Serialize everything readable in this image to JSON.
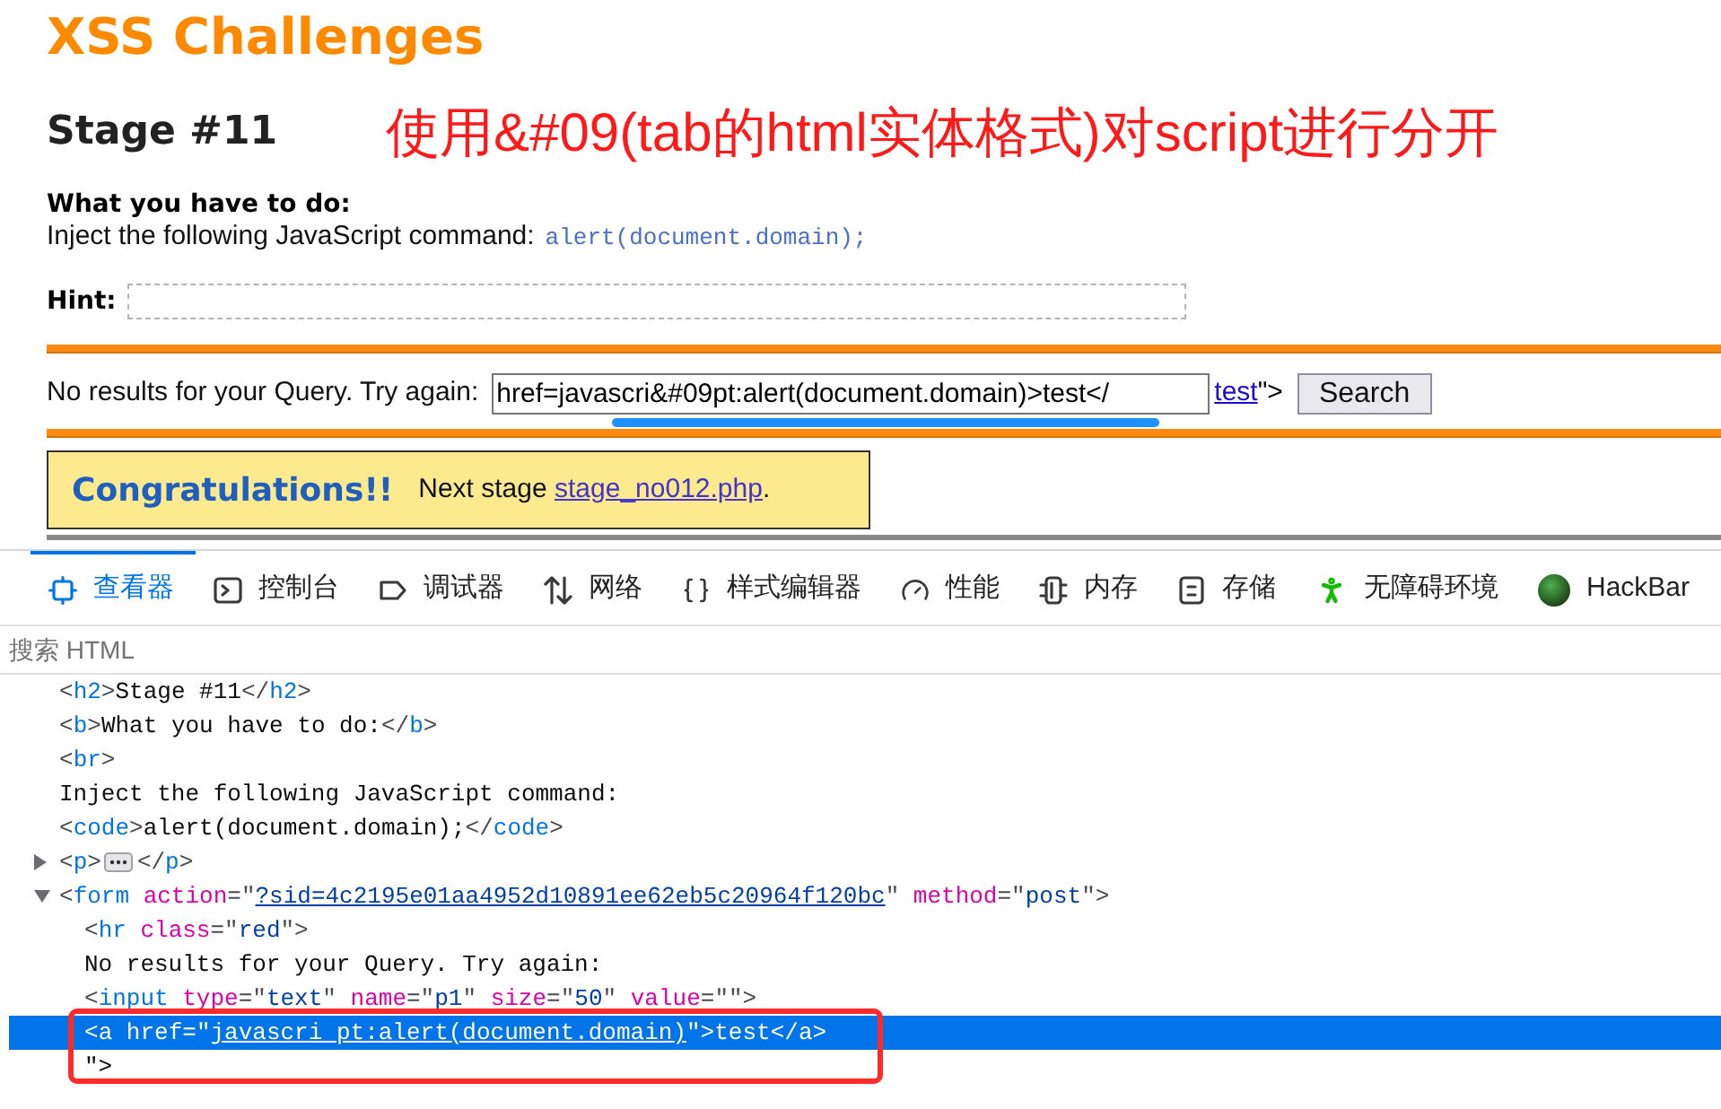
{
  "page": {
    "title": "XSS Challenges",
    "stage": "Stage #11",
    "annotation": "使用&#09(tab的html实体格式)对script进行分开",
    "task": {
      "heading": "What you have to do:",
      "text": "Inject the following JavaScript command:",
      "code": "alert(document.domain);"
    },
    "hint": {
      "label": "Hint:"
    },
    "query": {
      "text": "No results for your Query. Try again:",
      "value": "href=javascri&#09pt:alert(document.domain)>test</",
      "link": "test",
      "tail": "\">",
      "button": "Search"
    },
    "result": {
      "title": "Congratulations!!",
      "text": "Next stage",
      "link": "stage_no012.php",
      "end": "."
    }
  },
  "devtools": {
    "tabs": [
      {
        "label": "查看器",
        "selected": true
      },
      {
        "label": "控制台",
        "selected": false
      },
      {
        "label": "调试器",
        "selected": false
      },
      {
        "label": "网络",
        "selected": false
      },
      {
        "label": "样式编辑器",
        "selected": false
      },
      {
        "label": "性能",
        "selected": false
      },
      {
        "label": "内存",
        "selected": false
      },
      {
        "label": "存储",
        "selected": false
      },
      {
        "label": "无障碍环境",
        "selected": false
      },
      {
        "label": "HackBar",
        "selected": false
      }
    ],
    "search": {
      "placeholder": "搜索 HTML"
    },
    "tree": [
      {
        "kind": "leaf",
        "selected": false,
        "tokens": [
          {
            "kind": "punct",
            "text": "<"
          },
          {
            "kind": "tag",
            "text": "h2"
          },
          {
            "kind": "punct",
            "text": ">"
          },
          {
            "kind": "text",
            "text": "Stage #11"
          },
          {
            "kind": "punct",
            "text": "</"
          },
          {
            "kind": "tag",
            "text": "h2"
          },
          {
            "kind": "punct",
            "text": ">"
          }
        ]
      },
      {
        "kind": "leaf",
        "selected": false,
        "tokens": [
          {
            "kind": "punct",
            "text": "<"
          },
          {
            "kind": "tag",
            "text": "b"
          },
          {
            "kind": "punct",
            "text": ">"
          },
          {
            "kind": "text",
            "text": "What you have to do:"
          },
          {
            "kind": "punct",
            "text": "</"
          },
          {
            "kind": "tag",
            "text": "b"
          },
          {
            "kind": "punct",
            "text": ">"
          }
        ]
      },
      {
        "kind": "leaf",
        "selected": false,
        "tokens": [
          {
            "kind": "punct",
            "text": "<"
          },
          {
            "kind": "tag",
            "text": "br"
          },
          {
            "kind": "punct",
            "text": ">"
          }
        ]
      },
      {
        "kind": "leaf",
        "selected": false,
        "tokens": [
          {
            "kind": "text",
            "text": "Inject the following JavaScript command:"
          }
        ]
      },
      {
        "kind": "leaf",
        "selected": false,
        "tokens": [
          {
            "kind": "punct",
            "text": "<"
          },
          {
            "kind": "tag",
            "text": "code"
          },
          {
            "kind": "punct",
            "text": ">"
          },
          {
            "kind": "text",
            "text": "alert(document.domain);"
          },
          {
            "kind": "punct",
            "text": "</"
          },
          {
            "kind": "tag",
            "text": "code"
          },
          {
            "kind": "punct",
            "text": ">"
          }
        ]
      },
      {
        "kind": "container",
        "expanded": false,
        "selected": false,
        "tokens": [
          {
            "kind": "punct",
            "text": "<"
          },
          {
            "kind": "tag",
            "text": "p"
          },
          {
            "kind": "punct",
            "text": ">"
          },
          {
            "kind": "ellipsis"
          },
          {
            "kind": "punct",
            "text": "</"
          },
          {
            "kind": "tag",
            "text": "p"
          },
          {
            "kind": "punct",
            "text": ">"
          }
        ]
      },
      {
        "kind": "container",
        "expanded": true,
        "selected": false,
        "tokens": [
          {
            "kind": "punct",
            "text": "<"
          },
          {
            "kind": "tag",
            "text": "form"
          },
          {
            "kind": "attr",
            "text": " action"
          },
          {
            "kind": "punct",
            "text": "=\""
          },
          {
            "kind": "link",
            "text": "?sid=4c2195e01aa4952d10891ee62eb5c20964f120bc"
          },
          {
            "kind": "punct",
            "text": "\""
          },
          {
            "kind": "attr",
            "text": " method"
          },
          {
            "kind": "punct",
            "text": "=\""
          },
          {
            "kind": "value",
            "text": "post"
          },
          {
            "kind": "punct",
            "text": "\">"
          }
        ],
        "children": [
          {
            "kind": "leaf",
            "selected": false,
            "tokens": [
              {
                "kind": "punct",
                "text": "<"
              },
              {
                "kind": "tag",
                "text": "hr"
              },
              {
                "kind": "attr",
                "text": " class"
              },
              {
                "kind": "punct",
                "text": "=\""
              },
              {
                "kind": "value",
                "text": "red"
              },
              {
                "kind": "punct",
                "text": "\">"
              }
            ]
          },
          {
            "kind": "leaf",
            "selected": false,
            "tokens": [
              {
                "kind": "text",
                "text": "No results for your Query. Try again:"
              }
            ]
          },
          {
            "kind": "leaf",
            "selected": false,
            "tokens": [
              {
                "kind": "punct",
                "text": "<"
              },
              {
                "kind": "tag",
                "text": "input"
              },
              {
                "kind": "attr",
                "text": " type"
              },
              {
                "kind": "punct",
                "text": "=\""
              },
              {
                "kind": "value",
                "text": "text"
              },
              {
                "kind": "punct",
                "text": "\""
              },
              {
                "kind": "attr",
                "text": " name"
              },
              {
                "kind": "punct",
                "text": "=\""
              },
              {
                "kind": "value",
                "text": "p1"
              },
              {
                "kind": "punct",
                "text": "\""
              },
              {
                "kind": "attr",
                "text": " size"
              },
              {
                "kind": "punct",
                "text": "=\""
              },
              {
                "kind": "value",
                "text": "50"
              },
              {
                "kind": "punct",
                "text": "\""
              },
              {
                "kind": "attr",
                "text": " value"
              },
              {
                "kind": "punct",
                "text": "=\"\">"
              }
            ]
          },
          {
            "kind": "leaf",
            "selected": true,
            "tokens": [
              {
                "kind": "punct",
                "text": "<"
              },
              {
                "kind": "tag",
                "text": "a"
              },
              {
                "kind": "attr",
                "text": " href"
              },
              {
                "kind": "punct",
                "text": "=\""
              },
              {
                "kind": "link",
                "text": "javascri pt:alert(document.domain)"
              },
              {
                "kind": "punct",
                "text": "\">"
              },
              {
                "kind": "text",
                "text": "test"
              },
              {
                "kind": "punct",
                "text": "</"
              },
              {
                "kind": "tag",
                "text": "a"
              },
              {
                "kind": "punct",
                "text": ">"
              }
            ]
          },
          {
            "kind": "leaf",
            "selected": false,
            "tokens": [
              {
                "kind": "text",
                "text": "\">"
              }
            ]
          }
        ]
      }
    ]
  }
}
